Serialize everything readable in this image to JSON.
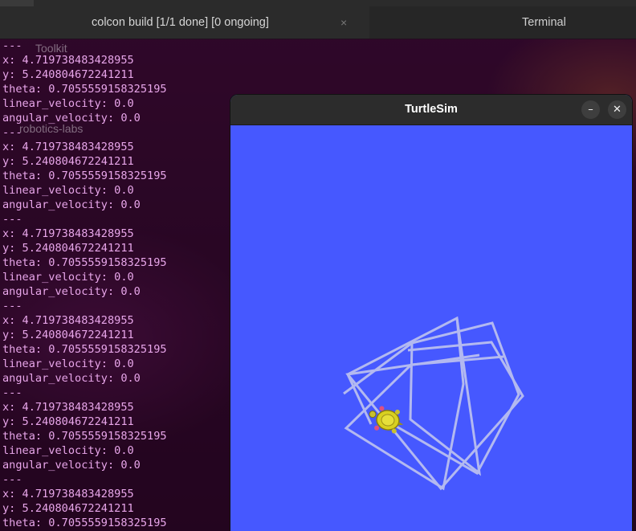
{
  "tabs": [
    {
      "label": "colcon build [1/1 done] [0 ongoing]",
      "close": "×"
    },
    {
      "label": "Terminal"
    }
  ],
  "desktop_labels": [
    "Toolkit",
    "robotics-labs"
  ],
  "terminal": {
    "lines": [
      "---",
      "x: 4.719738483428955",
      "y: 5.240804672241211",
      "theta: 0.7055559158325195",
      "linear_velocity: 0.0",
      "angular_velocity: 0.0",
      "---",
      "x: 4.719738483428955",
      "y: 5.240804672241211",
      "theta: 0.7055559158325195",
      "linear_velocity: 0.0",
      "angular_velocity: 0.0",
      "---",
      "x: 4.719738483428955",
      "y: 5.240804672241211",
      "theta: 0.7055559158325195",
      "linear_velocity: 0.0",
      "angular_velocity: 0.0",
      "---",
      "x: 4.719738483428955",
      "y: 5.240804672241211",
      "theta: 0.7055559158325195",
      "linear_velocity: 0.0",
      "angular_velocity: 0.0",
      "---",
      "x: 4.719738483428955",
      "y: 5.240804672241211",
      "theta: 0.7055559158325195",
      "linear_velocity: 0.0",
      "angular_velocity: 0.0",
      "---",
      "x: 4.719738483428955",
      "y: 5.240804672241211",
      "theta: 0.7055559158325195"
    ]
  },
  "turtlesim": {
    "title": "TurtleSim",
    "minimize_symbol": "–",
    "close_symbol": "✕",
    "background_color": "#4658ff",
    "pen_color": "#b3b9f0",
    "turtle_icon": "turtle-icon"
  }
}
